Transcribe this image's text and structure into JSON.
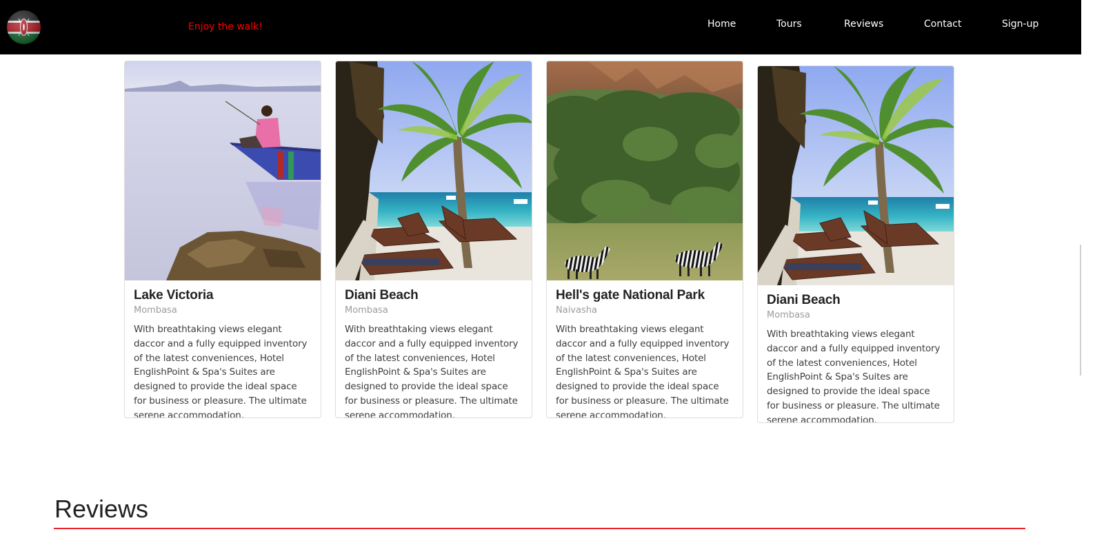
{
  "navbar": {
    "tagline": "Enjoy the walk!",
    "links": [
      {
        "label": "Home"
      },
      {
        "label": "Tours"
      },
      {
        "label": "Reviews"
      },
      {
        "label": "Contact"
      },
      {
        "label": "Sign-up"
      }
    ]
  },
  "colors": {
    "navbar_bg": "#000000",
    "tagline": "#ff0000",
    "accent_rule": "#e8242a"
  },
  "cards": [
    {
      "image": "lake-fisherman-boat",
      "title": "Lake Victoria",
      "location": "Mombasa",
      "description": "With breathtaking views elegant daccor and a fully equipped inventory of the latest conveniences, Hotel EnglishPoint & Spa's Suites are designed to provide the ideal space for business or pleasure. The ultimate serene accommodation."
    },
    {
      "image": "beach-palm-loungers",
      "title": "Diani Beach",
      "location": "Mombasa",
      "description": "With breathtaking views elegant daccor and a fully equipped inventory of the latest conveniences, Hotel EnglishPoint & Spa's Suites are designed to provide the ideal space for business or pleasure. The ultimate serene accommodation."
    },
    {
      "image": "zebras-cliffs-park",
      "title": "Hell's gate National Park",
      "location": "Naivasha",
      "description": "With breathtaking views elegant daccor and a fully equipped inventory of the latest conveniences, Hotel EnglishPoint & Spa's Suites are designed to provide the ideal space for business or pleasure. The ultimate serene accommodation."
    },
    {
      "image": "beach-palm-loungers",
      "title": "Diani Beach",
      "location": "Mombasa",
      "description": "With breathtaking views elegant daccor and a fully equipped inventory of the latest conveniences, Hotel EnglishPoint & Spa's Suites are designed to provide the ideal space for business or pleasure. The ultimate serene accommodation."
    }
  ],
  "reviews": {
    "heading": "Reviews"
  }
}
